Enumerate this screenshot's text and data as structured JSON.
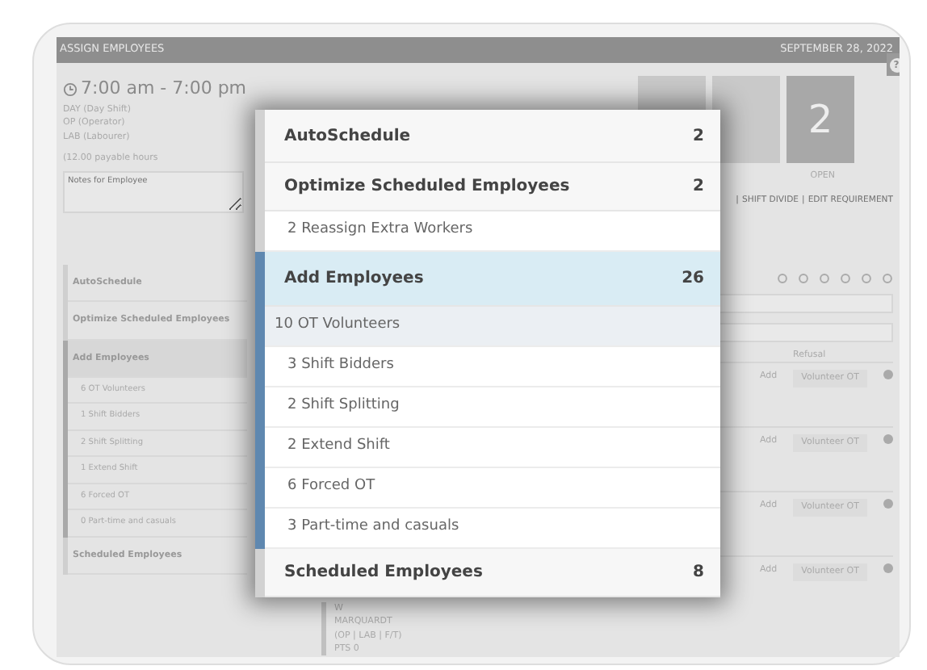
{
  "header": {
    "title": "ASSIGN EMPLOYEES",
    "date": "SEPTEMBER 28, 2022",
    "help": "?"
  },
  "shift": {
    "time": "7:00 am - 7:00 pm",
    "lines": [
      "DAY (Day Shift)",
      "OP (Operator)",
      "LAB (Labourer)"
    ],
    "payable": "(12.00 payable hours",
    "notes_placeholder": "Notes for Employee"
  },
  "side_menu": [
    {
      "label": "AutoSchedule",
      "selected": false
    },
    {
      "label": "Optimize Scheduled Employees",
      "selected": false
    },
    {
      "label": "Add Employees",
      "selected": true,
      "children": [
        "6 OT Volunteers",
        "1 Shift Bidders",
        "2 Shift Splitting",
        "1 Extend Shift",
        "6 Forced OT",
        "0 Part-time and casuals"
      ]
    },
    {
      "label": "Scheduled Employees",
      "selected": false
    }
  ],
  "open_count": {
    "value": "2",
    "label": "OPEN"
  },
  "links": {
    "separator": "|",
    "items": [
      "SHIFT DIVIDE",
      "EDIT REQUIREMENT"
    ]
  },
  "table": {
    "columns": [
      "Refusal"
    ],
    "rows": [
      {
        "action": "Add",
        "type": "Volunteer OT"
      },
      {
        "action": "Add",
        "type": "Volunteer OT"
      },
      {
        "action": "Add",
        "type": "Volunteer OT"
      },
      {
        "action": "Add",
        "type": "Volunteer OT"
      }
    ]
  },
  "employee": {
    "initial": "W",
    "name": "MARQUARDT",
    "groups": "(OP | LAB | F/T)",
    "pts": "PTS 0"
  },
  "modal": {
    "sections": [
      {
        "label": "AutoSchedule",
        "count": "2",
        "selected": false
      },
      {
        "label": "Optimize Scheduled Employees",
        "count": "2",
        "selected": false,
        "children": [
          {
            "label": "2 Reassign Extra Workers",
            "selected": false
          }
        ]
      },
      {
        "label": "Add Employees",
        "count": "26",
        "selected": true,
        "children": [
          {
            "label": "10 OT Volunteers",
            "selected": true
          },
          {
            "label": "3 Shift Bidders",
            "selected": false
          },
          {
            "label": "2 Shift Splitting",
            "selected": false
          },
          {
            "label": "2 Extend Shift",
            "selected": false
          },
          {
            "label": "6 Forced OT",
            "selected": false
          },
          {
            "label": "3 Part-time and casuals",
            "selected": false
          }
        ]
      },
      {
        "label": "Scheduled Employees",
        "count": "8",
        "selected": false
      }
    ]
  }
}
